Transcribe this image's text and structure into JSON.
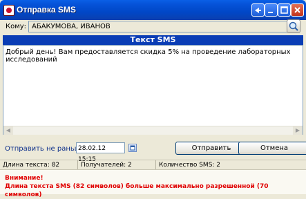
{
  "window": {
    "title": "Отправка SMS",
    "buttons": [
      "help",
      "minimize",
      "maximize",
      "close"
    ]
  },
  "to": {
    "label": "Кому:",
    "value": "АБАКУМОВА, ИВАНОВ",
    "search_icon": "search-icon"
  },
  "sms": {
    "header": "Текст SMS",
    "text": "Добрый день! Вам предоставляется скидка 5% на проведение лабораторных исследований"
  },
  "send": {
    "label": "Отправить не раньше:",
    "datetime": "28.02.12 15:15",
    "send_button": "Отправить",
    "cancel_button": "Отмена"
  },
  "status": {
    "text_length": "Длина текста: 82",
    "recipients": "Получателей: 2",
    "sms_count": "Количество SMS: 2"
  },
  "warning": {
    "title": "Внимание!",
    "message": "Длина текста SMS (82 символов) больше максимально разрешенной (70 символов)"
  },
  "colors": {
    "title_bar": "#0a5fe6",
    "header_bar": "#0a3db5",
    "warning_text": "#e00000"
  }
}
